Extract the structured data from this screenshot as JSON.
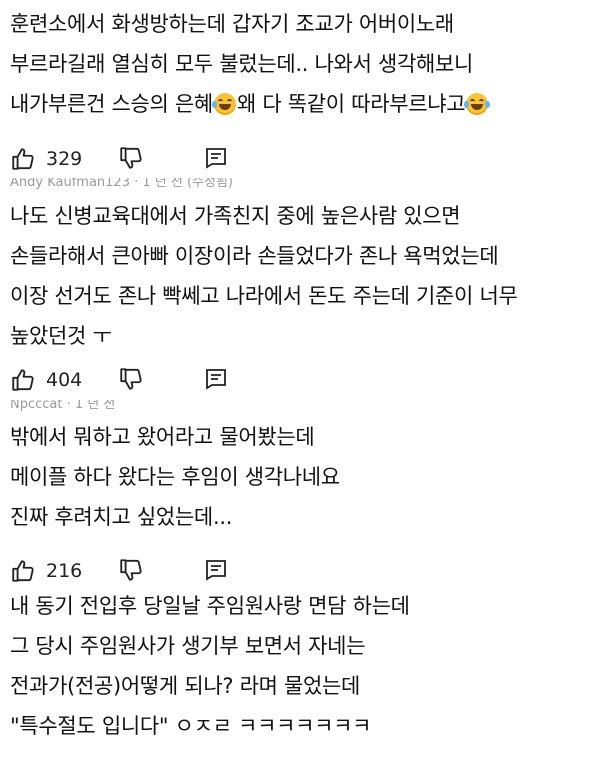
{
  "comments": [
    {
      "lines": [
        {
          "text": "훈련소에서 화생방하는데 갑자기 조교가 어버이노래"
        },
        {
          "text": "부르라길래 열심히 모두 불렀는데.. 나와서 생각해보니"
        },
        {
          "before": "내가부른건 스승의 은혜",
          "middle": "왜 다 똑같이 따라부르냐고",
          "after": ""
        }
      ],
      "emoji_left": "sweat-laugh-emoji",
      "emoji_right": "tears-of-joy-emoji",
      "likes": "329"
    },
    {
      "header_cut": "Andy Kaufman123 · 1 년 전 (수정됨)",
      "lines": [
        {
          "text": "나도 신병교육대에서 가족친지 중에 높은사람 있으면"
        },
        {
          "text": "손들라해서 큰아빠 이장이라 손들었다가 존나 욕먹었는데"
        },
        {
          "text": "이장 선거도 존나 빡쎄고 나라에서 돈도 주는데 기준이 너무"
        },
        {
          "text": "높았던것 ㅜ"
        }
      ],
      "likes": "404"
    },
    {
      "header_cut": "Npcccat · 1 년 전",
      "lines": [
        {
          "text": "밖에서 뭐하고 왔어라고 물어봤는데"
        },
        {
          "text": "메이플 하다 왔다는 후임이 생각나네요"
        },
        {
          "text": "진짜 후려치고 싶었는데..."
        }
      ],
      "likes": "216"
    },
    {
      "lines": [
        {
          "text": "내 동기 전입후 당일날 주임원사랑 면담 하는데"
        },
        {
          "text": "그 당시 주임원사가 생기부 보면서 자네는"
        },
        {
          "text": "전과가(전공)어떻게 되나? 라며 물었는데"
        },
        {
          "text": "\"특수절도 입니다\" ㅇㅈㄹ ㅋㅋㅋㅋㅋㅋㅋ"
        }
      ]
    }
  ],
  "icons": {
    "like": "thumbs-up-icon",
    "dislike": "thumbs-down-icon",
    "reply": "reply-comment-icon"
  }
}
